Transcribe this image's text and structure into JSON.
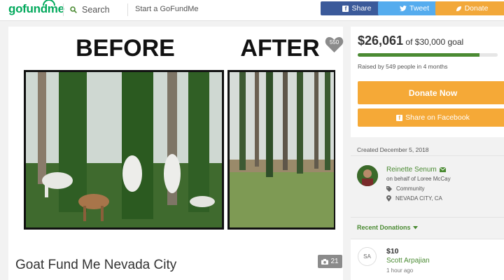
{
  "header": {
    "logo": "gofundme",
    "search_label": "Search",
    "start_label": "Start a GoFundMe",
    "share_label": "Share",
    "tweet_label": "Tweet",
    "donate_label": "Donate"
  },
  "campaign": {
    "title": "Goat Fund Me Nevada City",
    "photo_before": "BEFORE",
    "photo_after": "AFTER",
    "hearts": "550",
    "photo_count": "21"
  },
  "goal": {
    "raised": "$26,061",
    "goal_text": "of $30,000 goal",
    "progress_fraction": 0.8687,
    "raised_by": "Raised by 549 people in 4 months",
    "donate_now": "Donate Now",
    "share_facebook": "Share on Facebook"
  },
  "organizer": {
    "created": "Created December 5, 2018",
    "name": "Reinette Senum",
    "behalf": "on behalf of Loree McCay",
    "category": "Community",
    "location": "NEVADA CITY, CA"
  },
  "recent": {
    "header": "Recent Donations",
    "donations": [
      {
        "initials": "SA",
        "amount": "$10",
        "name": "Scott Arpajian",
        "time": "1 hour ago"
      }
    ]
  },
  "colors": {
    "brand_green": "#02a95c",
    "facebook": "#3b5a9a",
    "twitter": "#55acee",
    "donate_orange": "#f5a937",
    "progress_green": "#4a8a32"
  }
}
